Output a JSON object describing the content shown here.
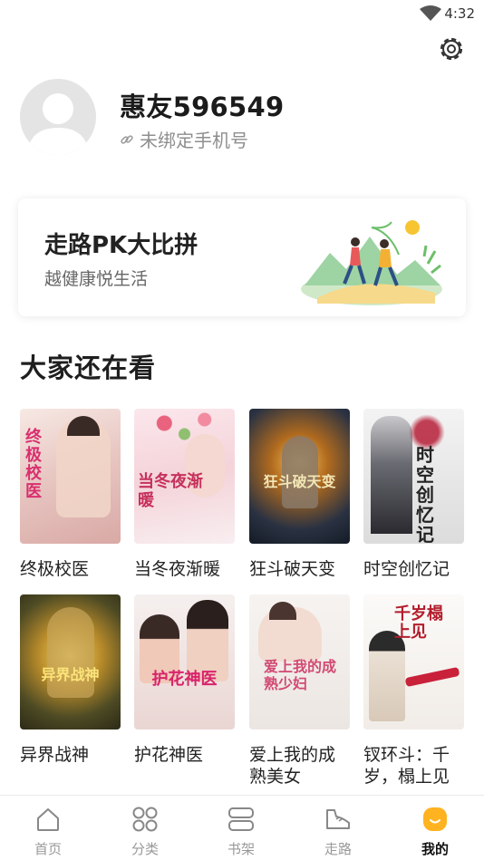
{
  "status_bar": {
    "time": "4:32",
    "wifi_icon": "wifi-icon"
  },
  "header": {
    "settings_icon": "gear-icon"
  },
  "profile": {
    "avatar_icon": "default-avatar-icon",
    "username": "惠友596549",
    "phone_status": "未绑定手机号",
    "phone_icon": "link-icon"
  },
  "promo": {
    "title": "走路PK大比拼",
    "subtitle": "越健康悦生活"
  },
  "section": {
    "title": "大家还在看"
  },
  "books": [
    {
      "title": "终极校医",
      "cover_text": "终极校医"
    },
    {
      "title": "当冬夜渐暖",
      "cover_text": "当冬夜渐暖"
    },
    {
      "title": "狂斗破天变",
      "cover_text": "狂斗破天变"
    },
    {
      "title": "时空创忆记",
      "cover_text": "时空创忆记"
    },
    {
      "title": "异界战神",
      "cover_text": "异界战神"
    },
    {
      "title": "护花神医",
      "cover_text": "护花神医"
    },
    {
      "title": "爱上我的成熟美女",
      "cover_text": "爱上我的成熟少妇"
    },
    {
      "title": "钗环斗：千岁，榻上见",
      "cover_text": "千岁榻上见"
    }
  ],
  "nav": {
    "items": [
      {
        "label": "首页",
        "icon": "home-icon",
        "active": false
      },
      {
        "label": "分类",
        "icon": "category-grid-icon",
        "active": false
      },
      {
        "label": "书架",
        "icon": "bookshelf-icon",
        "active": false
      },
      {
        "label": "走路",
        "icon": "shoe-icon",
        "active": false
      },
      {
        "label": "我的",
        "icon": "profile-icon",
        "active": true
      }
    ]
  },
  "colors": {
    "accent": "#FFB320",
    "text_primary": "#222222",
    "text_secondary": "#8E8E8E"
  }
}
